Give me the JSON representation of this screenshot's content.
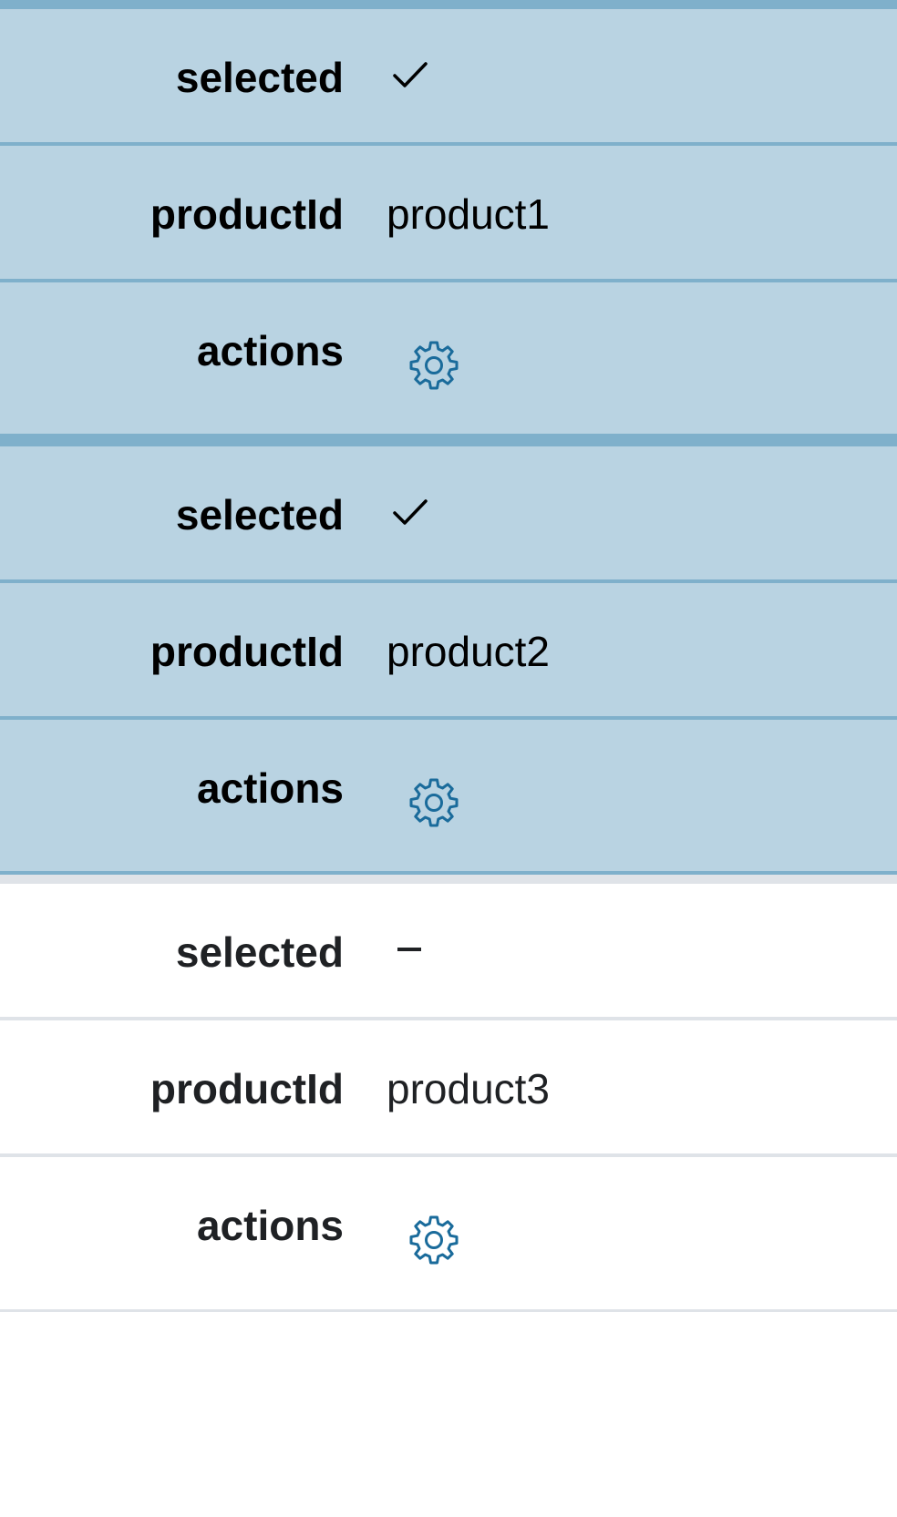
{
  "labels": {
    "selected": "selected",
    "product_id": "productId",
    "actions": "actions"
  },
  "rows": [
    {
      "selected": true,
      "product_id": "product1",
      "actions_icon": "gear-icon"
    },
    {
      "selected": true,
      "product_id": "product2",
      "actions_icon": "gear-icon"
    },
    {
      "selected": false,
      "product_id": "product3",
      "actions_icon": "gear-icon"
    }
  ],
  "colors": {
    "selected_row_bg": "#b9d3e2",
    "selected_row_border": "#7fb0cb",
    "unselected_row_border": "#dfe3e8",
    "gear_icon": "#1a6b9b"
  },
  "icons": {
    "selected_true": "check-icon",
    "selected_false": "dash-icon",
    "actions": "gear-icon"
  }
}
